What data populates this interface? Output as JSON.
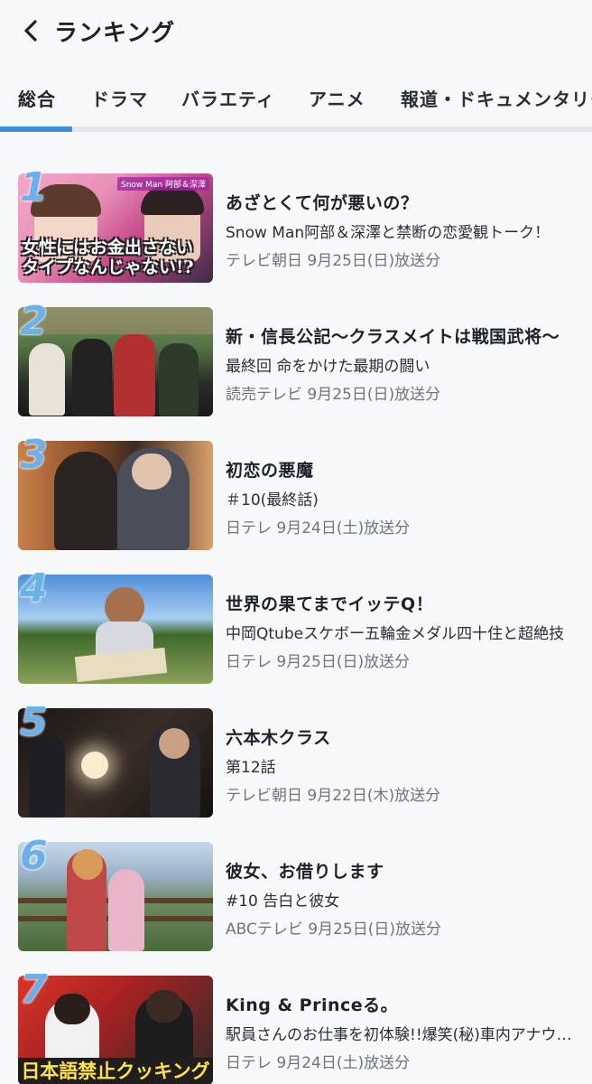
{
  "header": {
    "title": "ランキング",
    "back_icon": "chevron-left-icon"
  },
  "tabs": [
    {
      "label": "総合",
      "active": true
    },
    {
      "label": "ドラマ",
      "active": false
    },
    {
      "label": "バラエティ",
      "active": false
    },
    {
      "label": "アニメ",
      "active": false
    },
    {
      "label": "報道・ドキュメンタリー",
      "active": false
    }
  ],
  "colors": {
    "accent": "#3c8ed9",
    "rank": "#6bb0e8",
    "track": "#e3e6ec"
  },
  "items": [
    {
      "rank": "1",
      "title": "あざとくて何が悪いの？",
      "subtitle": "Snow Man阿部＆深澤と禁断の恋愛観トーク！",
      "meta": "テレビ朝日 9月25日(日)放送分",
      "thumb_text": "女性にはお金出さないタイプなんじゃない!?",
      "thumb_tag": "Snow Man 阿部＆深澤"
    },
    {
      "rank": "2",
      "title": "新・信長公記〜クラスメイトは戦国武将〜",
      "subtitle": "最終回 命をかけた最期の闘い",
      "meta": "読売テレビ 9月25日(日)放送分"
    },
    {
      "rank": "3",
      "title": "初恋の悪魔",
      "subtitle": "＃10(最終話)",
      "meta": "日テレ 9月24日(土)放送分"
    },
    {
      "rank": "4",
      "title": "世界の果てまでイッテQ！",
      "subtitle": "中岡Qtubeスケボー五輪金メダル四十住と超絶技",
      "meta": "日テレ 9月25日(日)放送分"
    },
    {
      "rank": "5",
      "title": "六本木クラス",
      "subtitle": "第12話",
      "meta": "テレビ朝日 9月22日(木)放送分"
    },
    {
      "rank": "6",
      "title": "彼女、お借りします",
      "subtitle": "#10 告白と彼女",
      "meta": "ABCテレビ 9月25日(日)放送分"
    },
    {
      "rank": "7",
      "title": "King & Princeる。",
      "subtitle": "駅員さんのお仕事を初体験!!爆笑(秘)車内アナウンス",
      "meta": "日テレ 9月24日(土)放送分",
      "thumb_text": "日本語禁止クッキング"
    }
  ]
}
